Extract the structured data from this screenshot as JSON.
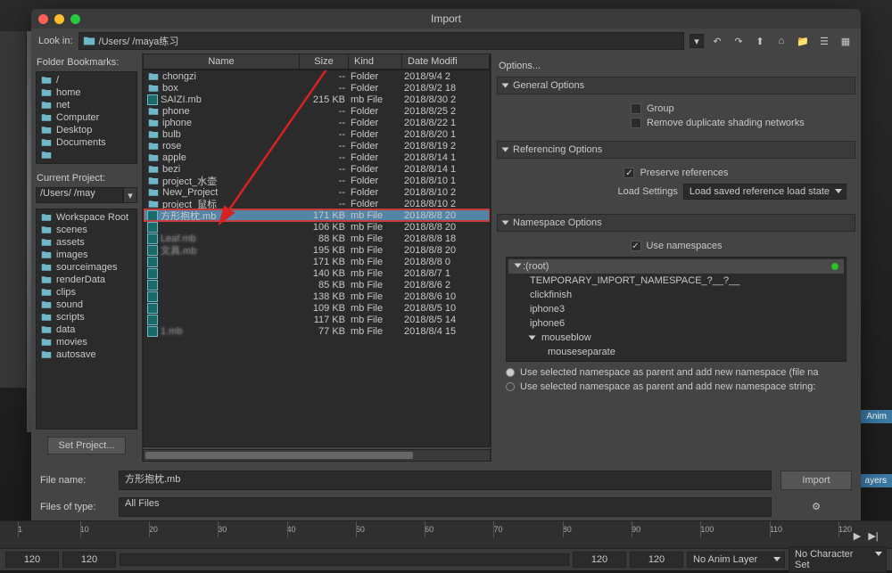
{
  "window": {
    "title": "Import"
  },
  "path": {
    "label": "Look in:",
    "value": "/Users/        /maya练习"
  },
  "bookmarks": {
    "header": "Folder Bookmarks:",
    "items": [
      "/",
      "home",
      "net",
      "Computer",
      "Desktop",
      "Documents",
      ""
    ]
  },
  "project": {
    "header": "Current Project:",
    "value": "/Users/      /may",
    "items": [
      "Workspace Root",
      "scenes",
      "assets",
      "images",
      "sourceimages",
      "renderData",
      "clips",
      "sound",
      "scripts",
      "data",
      "movies",
      "autosave"
    ],
    "set_project": "Set Project..."
  },
  "filelist": {
    "columns": {
      "name": "Name",
      "size": "Size",
      "kind": "Kind",
      "date": "Date Modifi"
    },
    "rows": [
      {
        "icon": "folder",
        "name": "chongzi",
        "size": "--",
        "kind": "Folder",
        "date": "2018/9/4 2"
      },
      {
        "icon": "folder",
        "name": "box",
        "size": "--",
        "kind": "Folder",
        "date": "2018/9/2 18"
      },
      {
        "icon": "maya",
        "name": "SAIZI.mb",
        "size": "215 KB",
        "kind": "mb File",
        "date": "2018/8/30 2"
      },
      {
        "icon": "folder",
        "name": "phone",
        "size": "--",
        "kind": "Folder",
        "date": "2018/8/25 2"
      },
      {
        "icon": "folder",
        "name": "iphone",
        "size": "--",
        "kind": "Folder",
        "date": "2018/8/22 1"
      },
      {
        "icon": "folder",
        "name": "bulb",
        "size": "--",
        "kind": "Folder",
        "date": "2018/8/20 1"
      },
      {
        "icon": "folder",
        "name": "rose",
        "size": "--",
        "kind": "Folder",
        "date": "2018/8/19 2"
      },
      {
        "icon": "folder",
        "name": "apple",
        "size": "--",
        "kind": "Folder",
        "date": "2018/8/14 1"
      },
      {
        "icon": "folder",
        "name": "bezi",
        "size": "--",
        "kind": "Folder",
        "date": "2018/8/14 1"
      },
      {
        "icon": "folder",
        "name": "project_水壶",
        "size": "--",
        "kind": "Folder",
        "date": "2018/8/10 1"
      },
      {
        "icon": "folder",
        "name": "New_Project",
        "size": "--",
        "kind": "Folder",
        "date": "2018/8/10 2"
      },
      {
        "icon": "folder",
        "name": "project_鼠标",
        "size": "--",
        "kind": "Folder",
        "date": "2018/8/10 2"
      },
      {
        "icon": "maya",
        "name": "方形抱枕.mb",
        "size": "171 KB",
        "kind": "mb File",
        "date": "2018/8/8 20",
        "selected": true
      },
      {
        "icon": "maya",
        "name": "",
        "size": "106 KB",
        "kind": "mb File",
        "date": "2018/8/8 20",
        "blur": true
      },
      {
        "icon": "maya",
        "name": "Leaf.mb",
        "size": "88 KB",
        "kind": "mb File",
        "date": "2018/8/8 18",
        "blur": true
      },
      {
        "icon": "maya",
        "name": "文具.mb",
        "size": "195 KB",
        "kind": "mb File",
        "date": "2018/8/8 20",
        "blur": true
      },
      {
        "icon": "maya",
        "name": "",
        "size": "171 KB",
        "kind": "mb File",
        "date": "2018/8/8 0",
        "blur": true
      },
      {
        "icon": "maya",
        "name": "",
        "size": "140 KB",
        "kind": "mb File",
        "date": "2018/8/7 1",
        "blur": true
      },
      {
        "icon": "maya",
        "name": "",
        "size": "85 KB",
        "kind": "mb File",
        "date": "2018/8/6 2",
        "blur": true
      },
      {
        "icon": "maya",
        "name": "",
        "size": "138 KB",
        "kind": "mb File",
        "date": "2018/8/6 10",
        "blur": true
      },
      {
        "icon": "maya",
        "name": "",
        "size": "109 KB",
        "kind": "mb File",
        "date": "2018/8/5 10",
        "blur": true
      },
      {
        "icon": "maya",
        "name": "",
        "size": "117 KB",
        "kind": "mb File",
        "date": "2018/8/5 14",
        "blur": true
      },
      {
        "icon": "maya",
        "name": "1.mb",
        "size": "77 KB",
        "kind": "mb File",
        "date": "2018/8/4 15",
        "blur": true
      }
    ]
  },
  "options": {
    "header": "Options...",
    "general": {
      "title": "General Options",
      "group": "Group",
      "dedupe": "Remove duplicate shading networks"
    },
    "referencing": {
      "title": "Referencing Options",
      "preserve": "Preserve references",
      "load_label": "Load Settings",
      "load_value": "Load saved reference load state"
    },
    "namespace": {
      "title": "Namespace Options",
      "use_ns": "Use namespaces",
      "root": ":(root)",
      "tree": [
        "TEMPORARY_IMPORT_NAMESPACE_?__?__",
        "clickfinish",
        "iphone3",
        "iphone6",
        "mouseblow",
        "mouseseparate"
      ],
      "radio1": "Use selected namespace as parent and add new namespace (file na",
      "radio2": "Use selected namespace as parent and add new namespace string:"
    }
  },
  "bottom": {
    "filename_label": "File name:",
    "filename_value": "方形抱枕.mb",
    "filetype_label": "Files of type:",
    "filetype_value": "All Files",
    "import_btn": "Import"
  },
  "timeline": {
    "ticks": [
      1,
      10,
      20,
      30,
      40,
      50,
      60,
      70,
      80,
      90,
      100,
      110,
      120
    ],
    "start": "120",
    "end": "120",
    "animlayer": "No Anim Layer",
    "charset": "No Character Set"
  },
  "edge": {
    "anim": "Anim",
    "layers": "ayers"
  }
}
